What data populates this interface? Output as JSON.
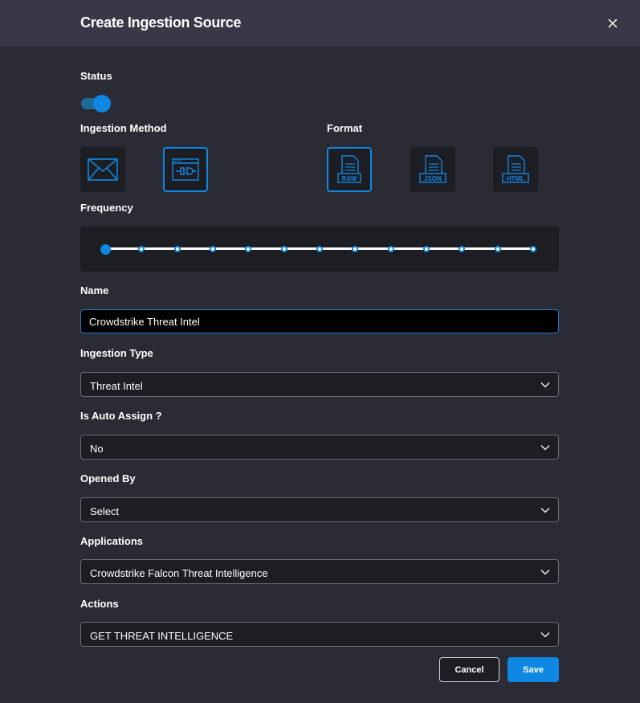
{
  "dialog": {
    "title": "Create Ingestion Source"
  },
  "colors": {
    "accent": "#0e88e2",
    "background": "#2b2b36",
    "header": "#383846",
    "tile": "#1d1d24"
  },
  "status": {
    "label": "Status",
    "enabled": true
  },
  "ingestion_method": {
    "label": "Ingestion Method",
    "options": [
      {
        "icon": "envelope-icon",
        "selected": false
      },
      {
        "icon": "api-plug-icon",
        "selected": true
      }
    ]
  },
  "format": {
    "label": "Format",
    "options": [
      {
        "icon": "raw-file-icon",
        "text": "RAW",
        "selected": true
      },
      {
        "icon": "json-file-icon",
        "text": "JSON",
        "selected": false
      },
      {
        "icon": "html-file-icon",
        "text": "HTML",
        "selected": false
      }
    ]
  },
  "frequency": {
    "label": "Frequency",
    "steps": 13,
    "selected_index": 0
  },
  "name": {
    "label": "Name",
    "value": "Crowdstrike Threat Intel"
  },
  "ingestion_type": {
    "label": "Ingestion Type",
    "value": "Threat Intel"
  },
  "auto_assign": {
    "label": "Is Auto Assign ?",
    "value": "No"
  },
  "opened_by": {
    "label": "Opened By",
    "value": "Select"
  },
  "applications": {
    "label": "Applications",
    "value": "Crowdstrike Falcon Threat Intelligence"
  },
  "actions": {
    "label": "Actions",
    "value": "GET THREAT INTELLIGENCE"
  },
  "buttons": {
    "cancel": "Cancel",
    "save": "Save"
  }
}
